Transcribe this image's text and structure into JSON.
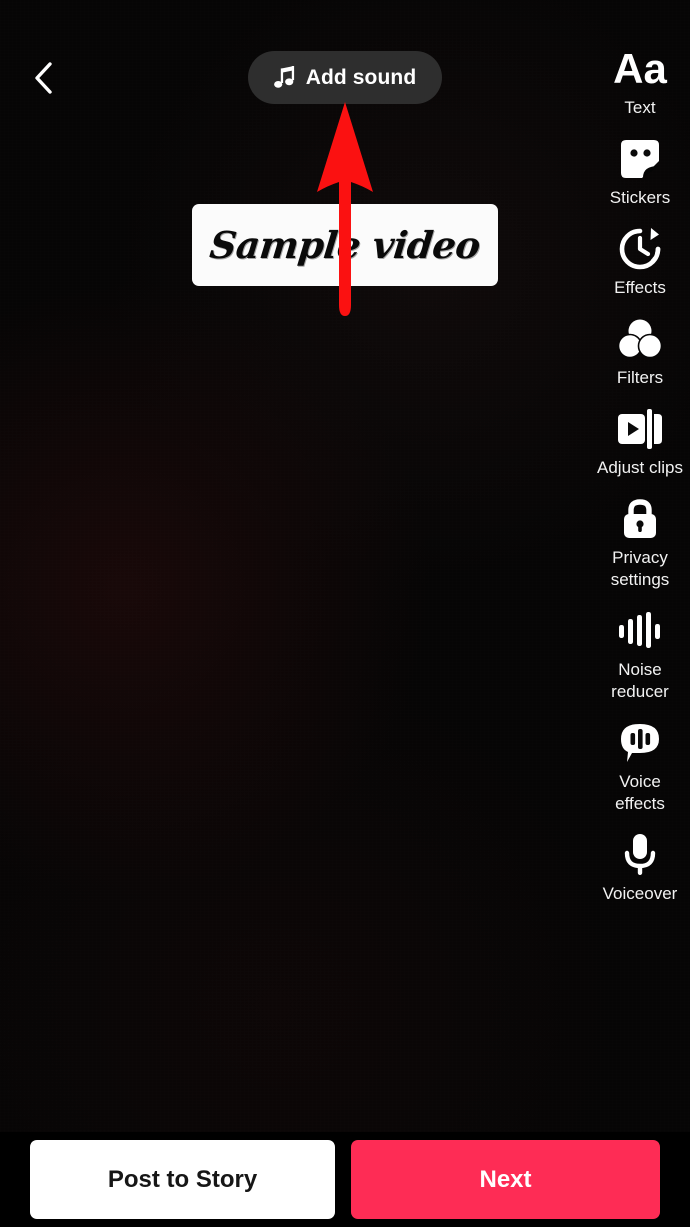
{
  "header": {
    "back_icon": "chevron-left-icon",
    "add_sound": {
      "label": "Add sound",
      "icon": "music-note-icon"
    }
  },
  "canvas": {
    "overlay_text": "Sample video",
    "annotation": {
      "type": "arrow",
      "color": "#fb1111",
      "direction": "up",
      "points_to": "Add sound"
    }
  },
  "sidebar": {
    "items": [
      {
        "label": "Text",
        "icon": "text-aa-icon"
      },
      {
        "label": "Stickers",
        "icon": "sticker-icon"
      },
      {
        "label": "Effects",
        "icon": "effects-clock-icon"
      },
      {
        "label": "Filters",
        "icon": "filters-circles-icon"
      },
      {
        "label": "Adjust clips",
        "icon": "adjust-clips-icon"
      },
      {
        "label": "Privacy\nsettings",
        "icon": "lock-icon"
      },
      {
        "label": "Noise\nreducer",
        "icon": "waveform-icon"
      },
      {
        "label": "Voice\neffects",
        "icon": "voice-effects-bubble-icon"
      },
      {
        "label": "Voiceover",
        "icon": "microphone-icon"
      }
    ]
  },
  "bottom": {
    "post_story_label": "Post to Story",
    "next_label": "Next"
  },
  "colors": {
    "accent": "#fe2c55",
    "annotation": "#fb1111",
    "pill": "#2e2e2e",
    "background": "#050404"
  }
}
